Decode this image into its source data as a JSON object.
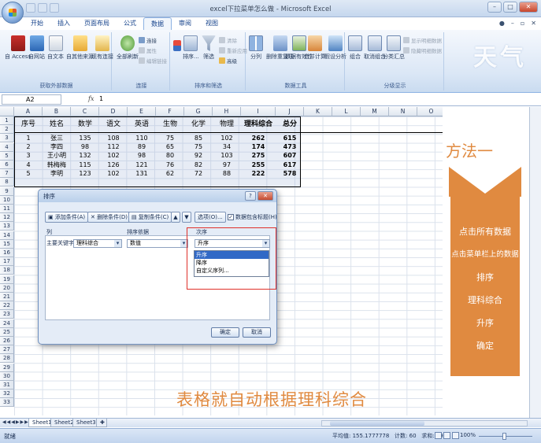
{
  "window": {
    "title": "excel下拉菜单怎么做 - Microsoft Excel"
  },
  "ribbon_tabs": [
    "开始",
    "插入",
    "页面布局",
    "公式",
    "数据",
    "审阅",
    "视图"
  ],
  "ribbon": {
    "groups": [
      {
        "label": "获取外部数据",
        "buttons": [
          "自 Access",
          "自网站",
          "自文本",
          "自其他来源",
          "现有连接"
        ]
      },
      {
        "label": "连接",
        "buttons": [
          "全部刷新"
        ],
        "small": [
          "连接",
          "属性",
          "编辑链接"
        ]
      },
      {
        "label": "排序和筛选",
        "buttons": [
          "排序...",
          "筛选"
        ],
        "small": [
          "清除",
          "重新应用",
          "高级"
        ]
      },
      {
        "label": "数据工具",
        "buttons": [
          "分列",
          "删除重复项",
          "数据有效性",
          "合并计算",
          "假设分析"
        ]
      },
      {
        "label": "分级显示",
        "buttons": [
          "组合",
          "取消组合",
          "分类汇总"
        ],
        "small": [
          "显示明细数据",
          "隐藏明细数据"
        ]
      }
    ],
    "watermark": "天气"
  },
  "formula_bar": {
    "name_box": "A2",
    "fx": "fx",
    "value": "1"
  },
  "columns": [
    "A",
    "B",
    "C",
    "D",
    "E",
    "F",
    "G",
    "H",
    "I",
    "J",
    "K",
    "L",
    "M",
    "N",
    "O"
  ],
  "rows": [
    "1",
    "2",
    "3",
    "4",
    "5",
    "6",
    "7",
    "8",
    "9",
    "10",
    "11",
    "12",
    "13",
    "14",
    "15",
    "16",
    "17",
    "18",
    "19",
    "20",
    "21",
    "22",
    "23",
    "24",
    "25",
    "26",
    "27",
    "28",
    "29",
    "30",
    "31",
    "32",
    "33"
  ],
  "table": {
    "headers": [
      "序号",
      "姓名",
      "数学",
      "语文",
      "英语",
      "生物",
      "化学",
      "物理",
      "理科综合",
      "总分"
    ],
    "rows": [
      [
        "1",
        "张三",
        "135",
        "108",
        "110",
        "75",
        "85",
        "102",
        "262",
        "615"
      ],
      [
        "2",
        "李四",
        "98",
        "112",
        "89",
        "65",
        "75",
        "34",
        "174",
        "473"
      ],
      [
        "3",
        "王小明",
        "132",
        "102",
        "98",
        "80",
        "92",
        "103",
        "275",
        "607"
      ],
      [
        "4",
        "韩梅梅",
        "115",
        "126",
        "121",
        "76",
        "82",
        "97",
        "255",
        "617"
      ],
      [
        "5",
        "李明",
        "123",
        "102",
        "131",
        "62",
        "72",
        "88",
        "222",
        "578"
      ]
    ]
  },
  "sort_dialog": {
    "title": "排序",
    "add_level": "添加条件(A)",
    "delete_level": "删除条件(D)",
    "copy_level": "复制条件(C)",
    "options": "选项(O)...",
    "header_checkbox": "数据包含标题(H)",
    "col_header": "列",
    "sort_on_header": "排序依据",
    "order_header": "次序",
    "row_label": "主要关键字",
    "column_value": "理科综合",
    "sort_on_value": "数值",
    "order_value": "升序",
    "order_options": [
      "升序",
      "降序",
      "自定义序列..."
    ],
    "ok": "确定",
    "cancel": "取消"
  },
  "annotation": {
    "method_title": "方法一",
    "steps": [
      "点击所有数据",
      "点击菜单栏上的数据",
      "排序",
      "理科综合",
      "升序",
      "确定"
    ],
    "caption": "表格就自动根据理科综合"
  },
  "sheets": [
    "Sheet1",
    "Sheet2",
    "Sheet3"
  ],
  "status": {
    "ready": "就绪",
    "average": "平均值: 155.1777778",
    "count": "计数: 60",
    "sum": "求和: 6983",
    "zoom": "100%"
  },
  "colors": {
    "accent": "#e08a40",
    "ribbon": "#dbe7f6",
    "highlight": "#e0302a"
  }
}
